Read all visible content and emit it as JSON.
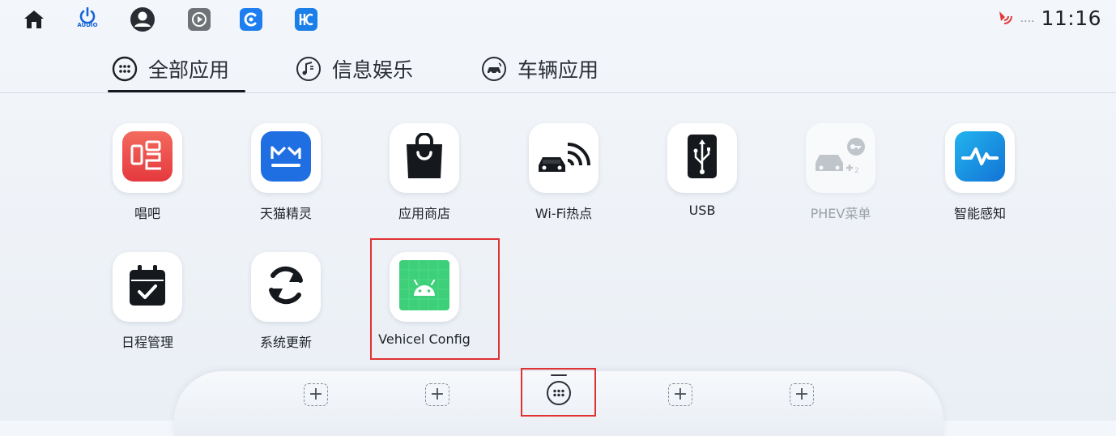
{
  "status_bar": {
    "audio_label": "AUDIO",
    "time": "11:16",
    "more": "....",
    "icons": [
      "home-icon",
      "power-audio-icon",
      "user-icon",
      "video-icon",
      "c-app-icon",
      "hc-app-icon",
      "signal-icon"
    ]
  },
  "tabs": [
    {
      "label": "全部应用",
      "icon": "grid-dots-icon",
      "active": true
    },
    {
      "label": "信息娱乐",
      "icon": "music-note-icon",
      "active": false
    },
    {
      "label": "车辆应用",
      "icon": "car-icon",
      "active": false
    }
  ],
  "apps": [
    {
      "label": "唱吧",
      "icon": "changba-icon"
    },
    {
      "label": "天猫精灵",
      "icon": "tmall-genie-icon"
    },
    {
      "label": "应用商店",
      "icon": "shopping-bag-icon"
    },
    {
      "label": "Wi-Fi热点",
      "icon": "car-wifi-icon"
    },
    {
      "label": "USB",
      "icon": "usb-icon"
    },
    {
      "label": "PHEV菜单",
      "icon": "phev-car-icon",
      "disabled": true
    },
    {
      "label": "智能感知",
      "icon": "pulse-icon"
    },
    {
      "label": "日程管理",
      "icon": "calendar-check-icon"
    },
    {
      "label": "系统更新",
      "icon": "refresh-icon"
    },
    {
      "label": "Vehicel Config",
      "icon": "android-icon",
      "highlighted": true
    }
  ],
  "dock": {
    "slots": [
      "add-slot-icon",
      "add-slot-icon",
      "all-apps-icon",
      "add-slot-icon",
      "add-slot-icon"
    ],
    "add_symbol": "+",
    "active_index": 2
  },
  "colors": {
    "accent_blue": "#1565d8",
    "changba_red": "#ef4a4a",
    "tmall_blue": "#1f6fe3",
    "android_green": "#3ecf79",
    "pulse_blue": "#1a9de4",
    "highlight_red": "#e03232",
    "signal_red": "#e23a3a"
  }
}
